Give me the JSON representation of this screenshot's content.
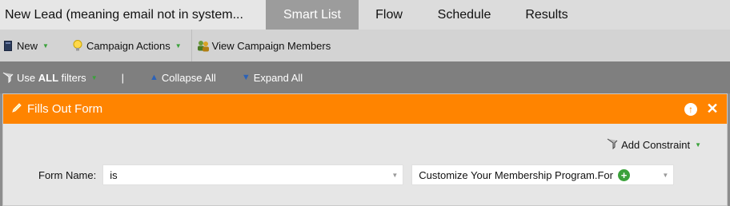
{
  "tabs": {
    "title": "New Lead (meaning email not in system...",
    "items": [
      {
        "label": "Smart List",
        "active": true
      },
      {
        "label": "Flow",
        "active": false
      },
      {
        "label": "Schedule",
        "active": false
      },
      {
        "label": "Results",
        "active": false
      }
    ]
  },
  "toolbar": {
    "new_label": "New",
    "campaign_actions_label": "Campaign Actions",
    "view_members_label": "View Campaign Members"
  },
  "filter_bar": {
    "use_filters_prefix": "Use ",
    "use_filters_bold": "ALL",
    "use_filters_suffix": " filters",
    "divider": "|",
    "collapse_all": "Collapse All",
    "expand_all": "Expand All"
  },
  "filter_card": {
    "title": "Fills Out Form",
    "add_constraint": "Add Constraint",
    "form_name_label": "Form Name:",
    "operator_value": "is",
    "form_value": "Customize Your Membership Program.For"
  },
  "colors": {
    "header_orange": "#ff8400",
    "accent_green": "#3aa13a",
    "accent_blue": "#2c62b7"
  }
}
